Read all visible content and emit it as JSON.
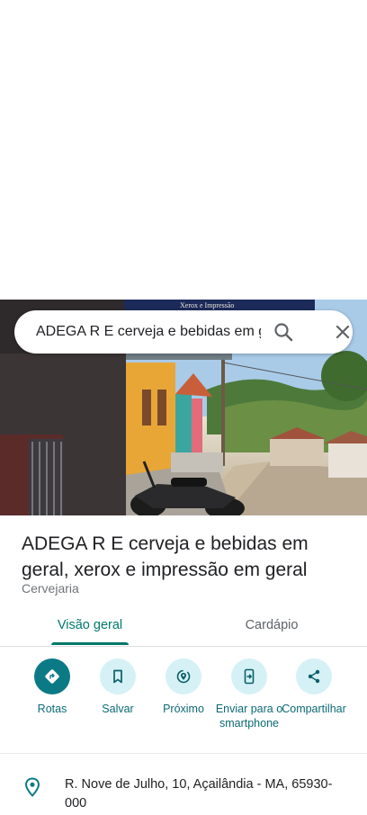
{
  "search": {
    "query": "ADEGA R E cerveja e bebidas em ge",
    "icons": [
      "search-icon",
      "close-icon"
    ]
  },
  "place": {
    "name": "ADEGA R E cerveja e bebidas em geral, xerox e impressão em geral",
    "category": "Cervejaria",
    "photo_sign_text": "Xerox e Impressão"
  },
  "tabs": [
    {
      "label": "Visão geral",
      "active": true
    },
    {
      "label": "Cardápio",
      "active": false
    }
  ],
  "actions": [
    {
      "label": "Rotas",
      "icon": "directions-icon"
    },
    {
      "label": "Salvar",
      "icon": "bookmark-icon"
    },
    {
      "label": "Próximo",
      "icon": "nearby-icon"
    },
    {
      "label": "Enviar para o smartphone",
      "icon": "send-to-phone-icon"
    },
    {
      "label": "Compartilhar",
      "icon": "share-icon"
    }
  ],
  "address": {
    "text": "R. Nove de Julho, 10, Açailândia - MA, 65930-000",
    "icon": "location-pin-icon"
  },
  "colors": {
    "accent": "#00796b",
    "action_primary_bg": "#0b7a85",
    "action_secondary_bg": "#d5f1f5",
    "action_label": "#0b6a75"
  }
}
